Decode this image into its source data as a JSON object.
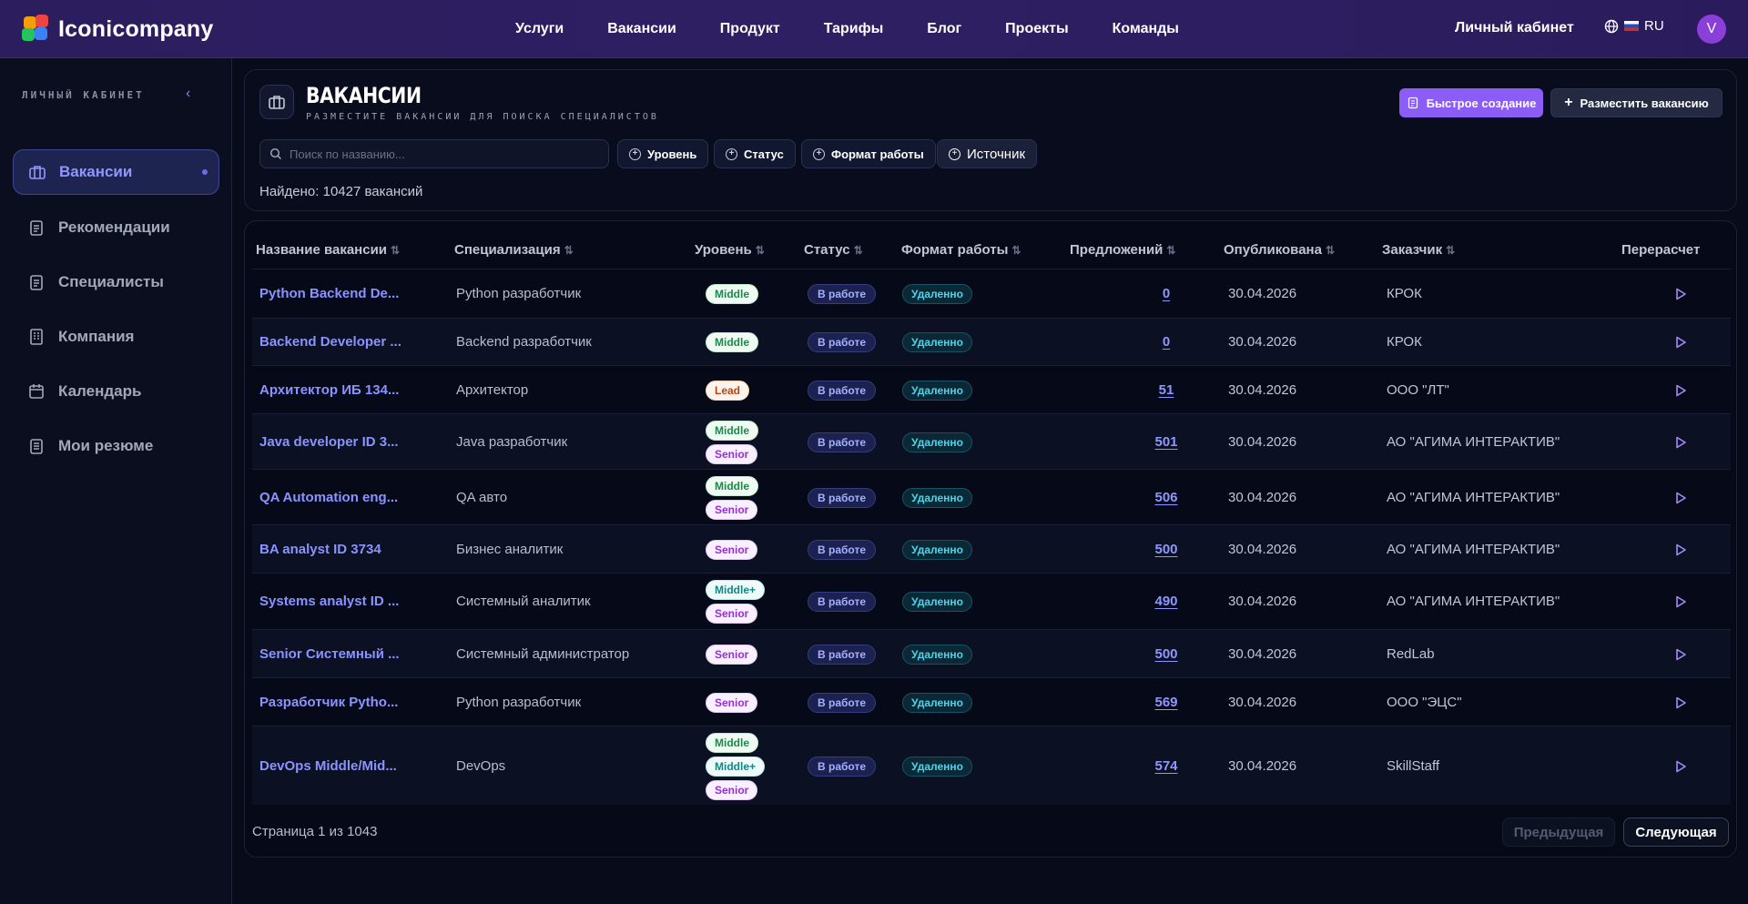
{
  "brand": {
    "name": "Iconicompany"
  },
  "nav": {
    "items": [
      "Услуги",
      "Вакансии",
      "Продукт",
      "Тарифы",
      "Блог",
      "Проекты",
      "Команды"
    ]
  },
  "header_right": {
    "cabinet": "Личный кабинет",
    "lang": "RU",
    "avatar": "V"
  },
  "sidebar": {
    "heading": "ЛИЧНЫЙ КАБИНЕТ",
    "items": [
      {
        "label": "Вакансии",
        "active": true
      },
      {
        "label": "Рекомендации"
      },
      {
        "label": "Специалисты"
      },
      {
        "label": "Компания"
      },
      {
        "label": "Календарь"
      },
      {
        "label": "Мои резюме"
      }
    ]
  },
  "page": {
    "title": "ВАКАНСИИ",
    "subtitle": "РАЗМЕСТИТЕ ВАКАНСИИ ДЛЯ ПОИСКА СПЕЦИАЛИСТОВ",
    "quick_create": "Быстрое создание",
    "post_vacancy": "Разместить вакансию",
    "search_placeholder": "Поиск по названию...",
    "filters": [
      "Уровень",
      "Статус",
      "Формат работы",
      "Источник"
    ],
    "found": "Найдено: 10427 вакансий"
  },
  "table": {
    "columns": [
      "Название вакансии",
      "Специализация",
      "Уровень",
      "Статус",
      "Формат работы",
      "Предложений",
      "Опубликована",
      "Заказчик",
      "Перерасчет"
    ],
    "rows": [
      {
        "name": "Python Backend De...",
        "spec": "Python разработчик",
        "levels": [
          "Middle"
        ],
        "status": "В работе",
        "format": "Удаленно",
        "offers": "0",
        "date": "30.04.2026",
        "client": "КРОК"
      },
      {
        "name": "Backend Developer ...",
        "spec": "Backend разработчик",
        "levels": [
          "Middle"
        ],
        "status": "В работе",
        "format": "Удаленно",
        "offers": "0",
        "date": "30.04.2026",
        "client": "КРОК"
      },
      {
        "name": "Архитектор ИБ 134...",
        "spec": "Архитектор",
        "levels": [
          "Lead"
        ],
        "status": "В работе",
        "format": "Удаленно",
        "offers": "51",
        "date": "30.04.2026",
        "client": "ООО \"ЛТ\""
      },
      {
        "name": "Java developer ID 3...",
        "spec": "Java разработчик",
        "levels": [
          "Middle",
          "Senior"
        ],
        "status": "В работе",
        "format": "Удаленно",
        "offers": "501",
        "date": "30.04.2026",
        "client": "АО \"АГИМА ИНТЕРАКТИВ\""
      },
      {
        "name": "QA Automation eng...",
        "spec": "QA авто",
        "levels": [
          "Middle",
          "Senior"
        ],
        "status": "В работе",
        "format": "Удаленно",
        "offers": "506",
        "date": "30.04.2026",
        "client": "АО \"АГИМА ИНТЕРАКТИВ\""
      },
      {
        "name": "BA analyst ID 3734",
        "spec": "Бизнес аналитик",
        "levels": [
          "Senior"
        ],
        "status": "В работе",
        "format": "Удаленно",
        "offers": "500",
        "date": "30.04.2026",
        "client": "АО \"АГИМА ИНТЕРАКТИВ\""
      },
      {
        "name": "Systems analyst ID ...",
        "spec": "Системный аналитик",
        "levels": [
          "Middle+",
          "Senior"
        ],
        "status": "В работе",
        "format": "Удаленно",
        "offers": "490",
        "date": "30.04.2026",
        "client": "АО \"АГИМА ИНТЕРАКТИВ\""
      },
      {
        "name": "Senior Системный ...",
        "spec": "Системный администратор",
        "levels": [
          "Senior"
        ],
        "status": "В работе",
        "format": "Удаленно",
        "offers": "500",
        "date": "30.04.2026",
        "client": "RedLab"
      },
      {
        "name": "Разработчик Pytho...",
        "spec": "Python разработчик",
        "levels": [
          "Senior"
        ],
        "status": "В работе",
        "format": "Удаленно",
        "offers": "569",
        "date": "30.04.2026",
        "client": "ООО \"ЭЦС\""
      },
      {
        "name": "DevOps Middle/Mid...",
        "spec": "DevOps",
        "levels": [
          "Middle",
          "Middle+",
          "Senior"
        ],
        "status": "В работе",
        "format": "Удаленно",
        "offers": "574",
        "date": "30.04.2026",
        "client": "SkillStaff"
      }
    ]
  },
  "pagination": {
    "text": "Страница 1 из 1043",
    "prev": "Предыдущая",
    "next": "Следующая"
  },
  "colors": {
    "accent": "#8b5cf6",
    "link": "#8a93ff",
    "nav_bg": "#2c1d5e",
    "bg": "#070b1a"
  }
}
